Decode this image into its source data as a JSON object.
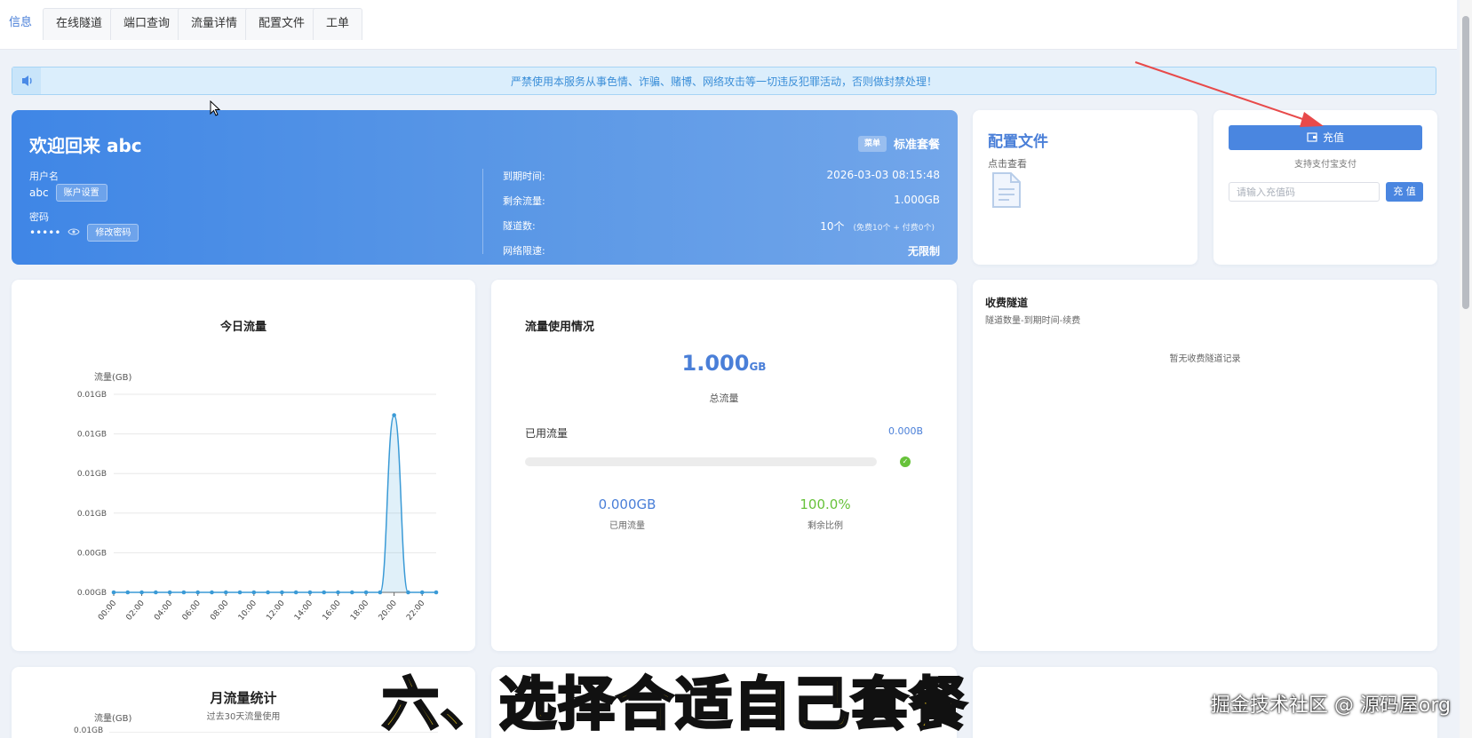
{
  "tabs": [
    {
      "label": "信息",
      "active": true
    },
    {
      "label": "在线隧道"
    },
    {
      "label": "端口查询"
    },
    {
      "label": "流量详情"
    },
    {
      "label": "配置文件"
    },
    {
      "label": "工单"
    }
  ],
  "notice": {
    "text": "严禁使用本服务从事色情、诈骗、赌博、网络攻击等一切违反犯罪活动，否则做封禁处理！",
    "icon": "speaker-icon"
  },
  "welcome": {
    "title": "欢迎回来 abc",
    "plan_icon": "菜单",
    "plan": "标准套餐",
    "username_label": "用户名",
    "username": "abc",
    "account_settings": "账户设置",
    "password_label": "密码",
    "password_mask": "•••••",
    "change_password": "修改密码",
    "expire_label": "到期时间:",
    "expire_value": "2026-03-03 08:15:48",
    "remaining_label": "剩余流量:",
    "remaining_value": "1.000GB",
    "tunnels_label": "隧道数:",
    "tunnels_value": "10个",
    "tunnels_detail": "(免费10个 + 付费0个)",
    "speed_label": "网络限速:",
    "speed_value": "无限制"
  },
  "config_card": {
    "title": "配置文件",
    "subtitle": "点击查看",
    "icon": "document-icon"
  },
  "recharge": {
    "button": "充值",
    "note": "支持支付宝支付",
    "placeholder": "请输入充值码",
    "submit": "充 值"
  },
  "today_traffic": {
    "title": "今日流量"
  },
  "usage": {
    "title": "流量使用情况",
    "total_value": "1.000",
    "total_unit": "GB",
    "total_label": "总流量",
    "used_label": "已用流量",
    "used_value": "0.000B",
    "used_percent": 0,
    "used_gb": "0.000GB",
    "used_gb_label": "已用流量",
    "remain_ratio": "100.0%",
    "remain_ratio_label": "剩余比例"
  },
  "paid_tunnels": {
    "title": "收费隧道",
    "subtitle": "隧道数量-到期时间-续费",
    "empty": "暂无收费隧道记录"
  },
  "monthly": {
    "title": "月流量统计",
    "subtitle": "过去30天流量使用",
    "ylabel": "流量(GB)",
    "ytick": "0.01GB"
  },
  "caption": "六、选择合适自己套餐",
  "watermark": "掘金技术社区 @ 源码屋org",
  "colors": {
    "accent": "#4a86e0",
    "green": "#67c23a",
    "banner": "#4a8ae6"
  },
  "chart_data": {
    "type": "area",
    "title": "",
    "ylabel": "流量(GB)",
    "xlabel": "",
    "x": [
      "00:00",
      "01:00",
      "02:00",
      "03:00",
      "04:00",
      "05:00",
      "06:00",
      "07:00",
      "08:00",
      "09:00",
      "10:00",
      "11:00",
      "12:00",
      "13:00",
      "14:00",
      "15:00",
      "16:00",
      "17:00",
      "18:00",
      "19:00",
      "20:00",
      "21:00",
      "22:00",
      "23:00"
    ],
    "xticks": [
      "00:00",
      "02:00",
      "04:00",
      "06:00",
      "08:00",
      "10:00",
      "12:00",
      "14:00",
      "16:00",
      "18:00",
      "20:00",
      "22:00"
    ],
    "yticks": [
      "0.00GB",
      "0.00GB",
      "0.01GB",
      "0.01GB",
      "0.01GB",
      "0.01GB"
    ],
    "ylim": [
      0,
      0.01
    ],
    "series": [
      {
        "values": [
          0,
          0,
          0,
          0,
          0,
          0,
          0,
          0,
          0,
          0,
          0,
          0,
          0,
          0,
          0,
          0,
          0,
          0,
          0,
          0,
          0.0095,
          0,
          0,
          0
        ]
      }
    ],
    "grid": true
  }
}
